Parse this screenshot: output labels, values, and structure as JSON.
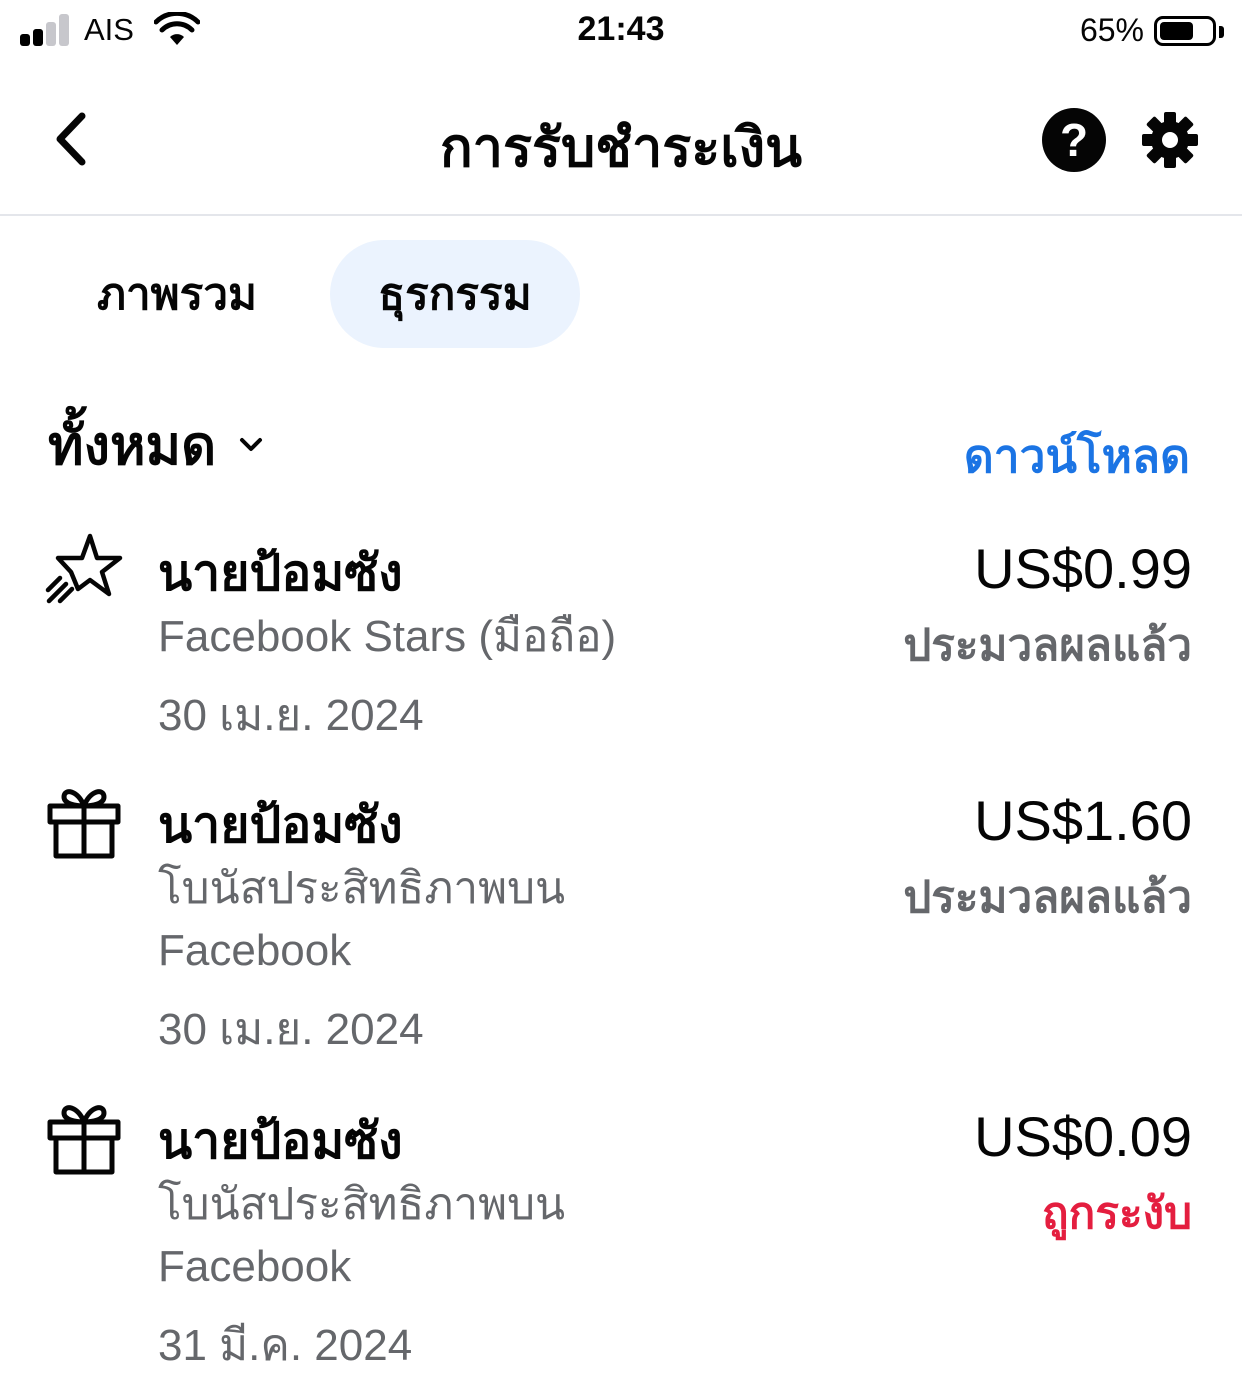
{
  "status_bar": {
    "carrier": "AIS",
    "time": "21:43",
    "battery": "65%",
    "battery_level": 0.65
  },
  "nav": {
    "title": "การรับชำระเงิน",
    "back_icon": "chevron-left-icon",
    "help_icon": "question-icon",
    "help_glyph": "?",
    "settings_icon": "gear-icon"
  },
  "tabs": [
    {
      "label": "ภาพรวม",
      "selected": false
    },
    {
      "label": "ธุรกรรม",
      "selected": true
    }
  ],
  "filter": {
    "label": "ทั้งหมด",
    "icon": "chevron-down-icon"
  },
  "download_label": "ดาวน์โหลด",
  "colors": {
    "accent": "#1b74e4",
    "tab_selected_bg": "#ebf3fe",
    "secondary_text": "#65676b",
    "status_processed": "#65676b",
    "status_suspended": "#e41e3f"
  },
  "transactions": [
    {
      "icon": "star-icon",
      "name": "นายป้อมซัง",
      "description": "Facebook Stars (มือถือ)",
      "date": "30 เม.ย. 2024",
      "amount": "US$0.99",
      "status": "ประมวลผลแล้ว"
    },
    {
      "icon": "gift-icon",
      "name": "นายป้อมซัง",
      "description": "โบนัสประสิทธิภาพบน Facebook",
      "date": "30 เม.ย. 2024",
      "amount": "US$1.60",
      "status": "ประมวลผลแล้ว"
    },
    {
      "icon": "gift-icon",
      "name": "นายป้อมซัง",
      "description": "โบนัสประสิทธิภาพบน Facebook",
      "date": "31 มี.ค. 2024",
      "amount": "US$0.09",
      "status": "ถูกระงับ"
    }
  ]
}
